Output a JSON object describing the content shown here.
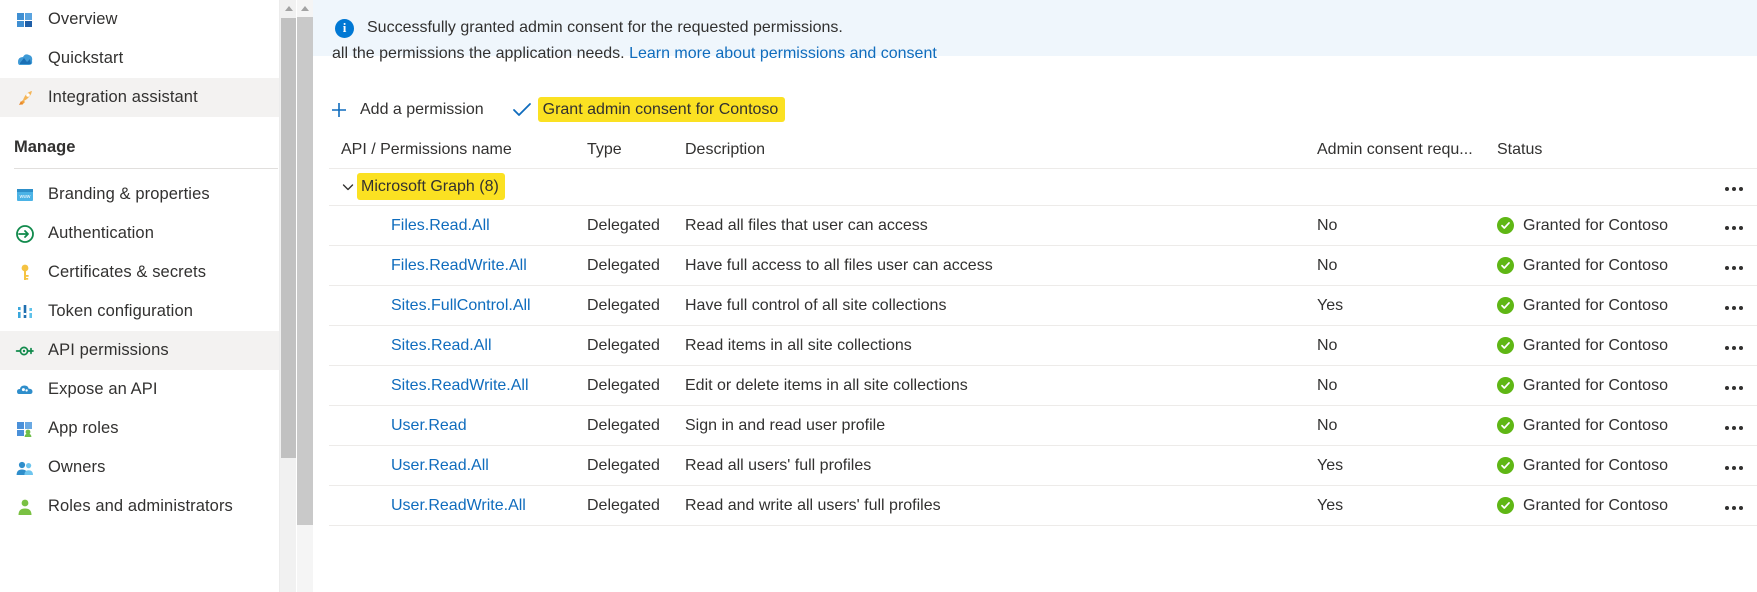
{
  "sidebar": {
    "items": [
      {
        "label": "Overview",
        "icon": "overview-grid-icon",
        "selected": false,
        "type": "item"
      },
      {
        "label": "Quickstart",
        "icon": "quickstart-rocket-cloud-icon",
        "selected": false,
        "type": "item"
      },
      {
        "label": "Integration assistant",
        "icon": "rocket-icon",
        "selected": true,
        "type": "item"
      },
      {
        "label": "Manage",
        "icon": "",
        "selected": false,
        "type": "section"
      },
      {
        "label": "Branding & properties",
        "icon": "branding-window-icon",
        "selected": false,
        "type": "item"
      },
      {
        "label": "Authentication",
        "icon": "authentication-arrow-icon",
        "selected": false,
        "type": "item"
      },
      {
        "label": "Certificates & secrets",
        "icon": "key-icon",
        "selected": false,
        "type": "item"
      },
      {
        "label": "Token configuration",
        "icon": "token-bars-icon",
        "selected": false,
        "type": "item"
      },
      {
        "label": "API permissions",
        "icon": "api-permissions-key-icon",
        "selected": true,
        "type": "item"
      },
      {
        "label": "Expose an API",
        "icon": "cloud-icon",
        "selected": false,
        "type": "item"
      },
      {
        "label": "App roles",
        "icon": "app-roles-icon",
        "selected": false,
        "type": "item"
      },
      {
        "label": "Owners",
        "icon": "owners-people-icon",
        "selected": false,
        "type": "item"
      },
      {
        "label": "Roles and administrators",
        "icon": "roles-admins-icon",
        "selected": false,
        "type": "item"
      }
    ]
  },
  "banner": {
    "icon": "info-icon",
    "message": "Successfully granted admin consent for the requested permissions.",
    "background": "#eff6fc",
    "icon_color": "#0078d4"
  },
  "clipped_text": {
    "prefix": "all the permissions the application needs. ",
    "link": "Learn more about permissions and consent"
  },
  "commandbar": {
    "add_permission": {
      "label": "Add a permission",
      "icon": "plus-icon"
    },
    "grant_consent": {
      "label": "Grant admin consent for Contoso",
      "icon": "checkmark-icon",
      "highlighted": true
    }
  },
  "table": {
    "columns": [
      "API / Permissions name",
      "Type",
      "Description",
      "Admin consent requ...",
      "Status"
    ],
    "group": {
      "label": "Microsoft Graph (8)",
      "expanded": true,
      "chevron": "chevron-down-icon",
      "highlighted": true
    },
    "rows": [
      {
        "name": "Files.Read.All",
        "type": "Delegated",
        "description": "Read all files that user can access",
        "admin_consent_required": "No",
        "status": "Granted for Contoso",
        "status_icon": "green-check-icon"
      },
      {
        "name": "Files.ReadWrite.All",
        "type": "Delegated",
        "description": "Have full access to all files user can access",
        "admin_consent_required": "No",
        "status": "Granted for Contoso",
        "status_icon": "green-check-icon"
      },
      {
        "name": "Sites.FullControl.All",
        "type": "Delegated",
        "description": "Have full control of all site collections",
        "admin_consent_required": "Yes",
        "status": "Granted for Contoso",
        "status_icon": "green-check-icon"
      },
      {
        "name": "Sites.Read.All",
        "type": "Delegated",
        "description": "Read items in all site collections",
        "admin_consent_required": "No",
        "status": "Granted for Contoso",
        "status_icon": "green-check-icon"
      },
      {
        "name": "Sites.ReadWrite.All",
        "type": "Delegated",
        "description": "Edit or delete items in all site collections",
        "admin_consent_required": "No",
        "status": "Granted for Contoso",
        "status_icon": "green-check-icon"
      },
      {
        "name": "User.Read",
        "type": "Delegated",
        "description": "Sign in and read user profile",
        "admin_consent_required": "No",
        "status": "Granted for Contoso",
        "status_icon": "green-check-icon"
      },
      {
        "name": "User.Read.All",
        "type": "Delegated",
        "description": "Read all users' full profiles",
        "admin_consent_required": "Yes",
        "status": "Granted for Contoso",
        "status_icon": "green-check-icon"
      },
      {
        "name": "User.ReadWrite.All",
        "type": "Delegated",
        "description": "Read and write all users' full profiles",
        "admin_consent_required": "Yes",
        "status": "Granted for Contoso",
        "status_icon": "green-check-icon"
      }
    ]
  },
  "colors": {
    "link": "#0f6cbd",
    "highlight": "#fbe122",
    "success_green": "#5fb715",
    "selected_nav": "#f3f2f1"
  }
}
